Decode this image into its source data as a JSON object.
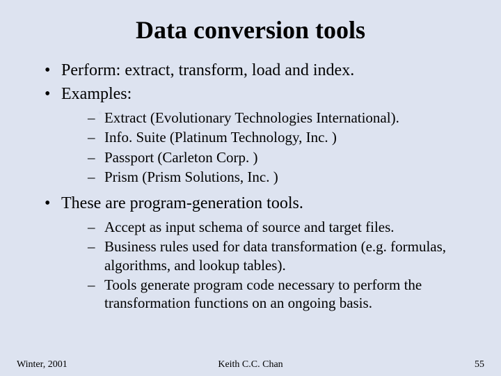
{
  "title": "Data conversion tools",
  "bullets": {
    "b1": "Perform: extract, transform, load and index.",
    "b2": "Examples:",
    "b2_items": {
      "i1": "Extract (Evolutionary Technologies International).",
      "i2": "Info. Suite (Platinum Technology, Inc. )",
      "i3": "Passport (Carleton Corp. )",
      "i4": "Prism (Prism Solutions, Inc. )"
    },
    "b3": "These are program-generation tools.",
    "b3_items": {
      "i1": "Accept as input schema of source and target files.",
      "i2": "Business rules used for data transformation (e.g. formulas, algorithms, and lookup tables).",
      "i3": "Tools generate program code necessary to perform the transformation functions on an ongoing basis."
    }
  },
  "footer": {
    "left": "Winter, 2001",
    "center": "Keith C.C. Chan",
    "right": "55"
  }
}
